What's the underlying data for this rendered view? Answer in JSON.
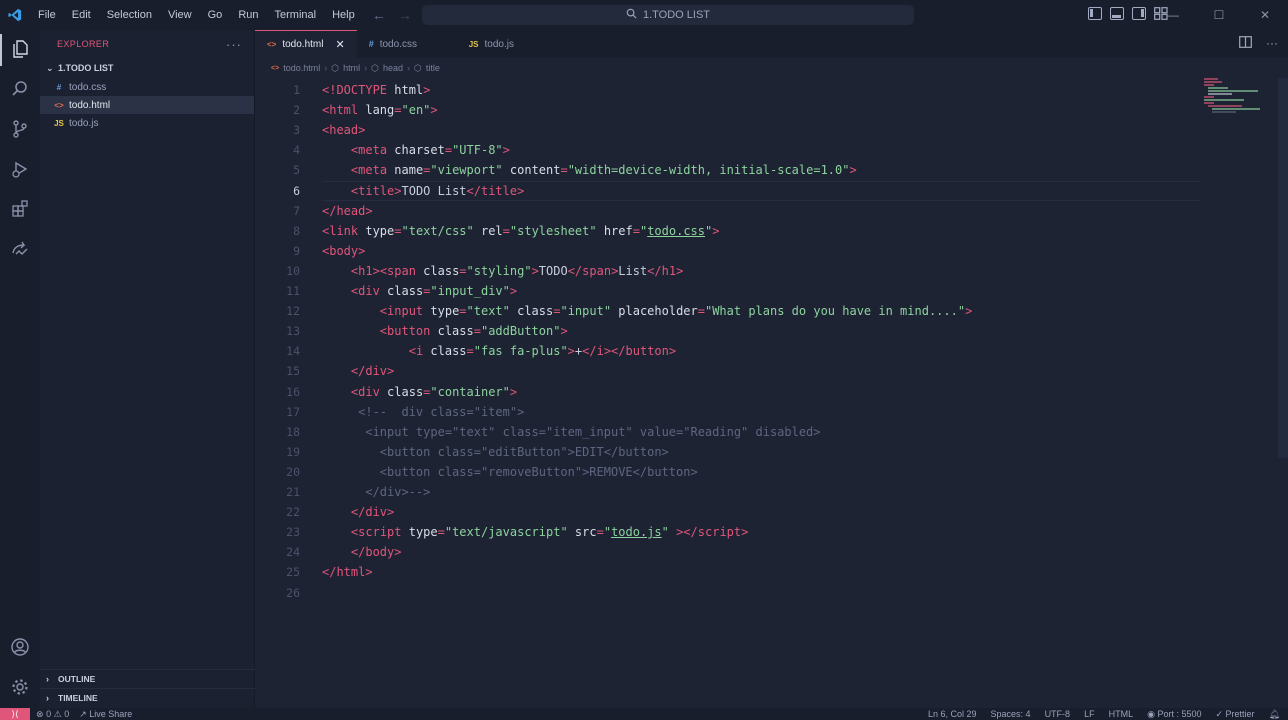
{
  "titlebar": {
    "menu": [
      "File",
      "Edit",
      "Selection",
      "View",
      "Go",
      "Run",
      "Terminal",
      "Help"
    ],
    "search_text": "1.TODO LIST"
  },
  "sidebar": {
    "header": "EXPLORER",
    "more": "···",
    "folder": "1.TODO LIST",
    "files": [
      {
        "icon": "#",
        "name": "todo.css",
        "color": "#6a9fdc"
      },
      {
        "icon": "<>",
        "name": "todo.html",
        "color": "#e06c4a"
      },
      {
        "icon": "JS",
        "name": "todo.js",
        "color": "#e3c449"
      }
    ],
    "outline": "OUTLINE",
    "timeline": "TIMELINE"
  },
  "tabs": [
    {
      "icon": "<>",
      "label": "todo.html",
      "color": "#e06c4a",
      "close": "✕"
    },
    {
      "icon": "#",
      "label": "todo.css",
      "color": "#6a9fdc"
    },
    {
      "icon": "JS",
      "label": "todo.js",
      "color": "#e3c449"
    }
  ],
  "breadcrumb": [
    "todo.html",
    "html",
    "head",
    "title"
  ],
  "code_lines": [
    {
      "n": "1",
      "html": "<span class='t-punc'>&lt;!DOCTYPE </span><span class='t-attr'>html</span><span class='t-punc'>&gt;</span>"
    },
    {
      "n": "2",
      "html": "<span class='t-punc'>&lt;</span><span class='t-tag'>html </span><span class='t-attr'>lang</span><span class='t-punc'>=</span><span class='t-str'>\"en\"</span><span class='t-punc'>&gt;</span>"
    },
    {
      "n": "3",
      "html": "<span class='t-punc'>&lt;</span><span class='t-tag'>head</span><span class='t-punc'>&gt;</span>"
    },
    {
      "n": "4",
      "html": "    <span class='t-punc'>&lt;</span><span class='t-tag'>meta </span><span class='t-attr'>charset</span><span class='t-punc'>=</span><span class='t-str'>\"UTF-8\"</span><span class='t-punc'>&gt;</span>"
    },
    {
      "n": "5",
      "html": "    <span class='t-punc'>&lt;</span><span class='t-tag'>meta </span><span class='t-attr'>name</span><span class='t-punc'>=</span><span class='t-str'>\"viewport\" </span><span class='t-attr'>content</span><span class='t-punc'>=</span><span class='t-str'>\"width=device-width, initial-scale=1.0\"</span><span class='t-punc'>&gt;</span>"
    },
    {
      "n": "6",
      "html": "    <span class='t-punc'>&lt;</span><span class='t-tag'>title</span><span class='t-punc'>&gt;</span><span class='t-text'>TODO List</span><span class='t-punc'>&lt;/</span><span class='t-tag'>title</span><span class='t-punc'>&gt;</span>",
      "current": true
    },
    {
      "n": "7",
      "html": "<span class='t-punc'>&lt;/</span><span class='t-tag'>head</span><span class='t-punc'>&gt;</span>"
    },
    {
      "n": "8",
      "html": "<span class='t-punc'>&lt;</span><span class='t-tag'>link </span><span class='t-attr'>type</span><span class='t-punc'>=</span><span class='t-str'>\"text/css\" </span><span class='t-attr'>rel</span><span class='t-punc'>=</span><span class='t-str'>\"stylesheet\" </span><span class='t-attr'>href</span><span class='t-punc'>=</span><span class='t-str'>\"</span><span class='t-link'>todo.css</span><span class='t-str'>\"</span><span class='t-punc'>&gt;</span>"
    },
    {
      "n": "9",
      "html": "<span class='t-punc'>&lt;</span><span class='t-tag'>body</span><span class='t-punc'>&gt;</span>"
    },
    {
      "n": "10",
      "html": "    <span class='t-punc'>&lt;</span><span class='t-tag'>h1</span><span class='t-punc'>&gt;&lt;</span><span class='t-tag'>span </span><span class='t-attr'>class</span><span class='t-punc'>=</span><span class='t-str'>\"styling\"</span><span class='t-punc'>&gt;</span><span class='t-text'>TODO</span><span class='t-punc'>&lt;/</span><span class='t-tag'>span</span><span class='t-punc'>&gt;</span><span class='t-text'>List</span><span class='t-punc'>&lt;/</span><span class='t-tag'>h1</span><span class='t-punc'>&gt;</span>"
    },
    {
      "n": "11",
      "html": "    <span class='t-punc'>&lt;</span><span class='t-tag'>div </span><span class='t-attr'>class</span><span class='t-punc'>=</span><span class='t-str'>\"input_div\"</span><span class='t-punc'>&gt;</span>"
    },
    {
      "n": "12",
      "html": "        <span class='t-punc'>&lt;</span><span class='t-tag'>input </span><span class='t-attr'>type</span><span class='t-punc'>=</span><span class='t-str'>\"text\" </span><span class='t-attr'>class</span><span class='t-punc'>=</span><span class='t-str'>\"input\" </span><span class='t-attr'>placeholder</span><span class='t-punc'>=</span><span class='t-str'>\"What plans do you have in mind....\"</span><span class='t-punc'>&gt;</span>"
    },
    {
      "n": "13",
      "html": "        <span class='t-punc'>&lt;</span><span class='t-tag'>button </span><span class='t-attr'>class</span><span class='t-punc'>=</span><span class='t-str'>\"addButton\"</span><span class='t-punc'>&gt;</span>"
    },
    {
      "n": "14",
      "html": "            <span class='t-punc'>&lt;</span><span class='t-tag'>i </span><span class='t-attr'>class</span><span class='t-punc'>=</span><span class='t-str'>\"fas fa-plus\"</span><span class='t-punc'>&gt;</span><span class='t-text'>+</span><span class='t-punc'>&lt;/</span><span class='t-tag'>i</span><span class='t-punc'>&gt;&lt;/</span><span class='t-tag'>button</span><span class='t-punc'>&gt;</span>"
    },
    {
      "n": "15",
      "html": "    <span class='t-punc'>&lt;/</span><span class='t-tag'>div</span><span class='t-punc'>&gt;</span>"
    },
    {
      "n": "16",
      "html": "    <span class='t-punc'>&lt;</span><span class='t-tag'>div </span><span class='t-attr'>class</span><span class='t-punc'>=</span><span class='t-str'>\"container\"</span><span class='t-punc'>&gt;</span>"
    },
    {
      "n": "17",
      "html": "     <span class='t-cmt'>&lt;!--  div class=\"item\"&gt;</span>"
    },
    {
      "n": "18",
      "html": "      <span class='t-cmt'>&lt;input type=\"text\" class=\"item_input\" value=\"Reading\" disabled&gt;</span>"
    },
    {
      "n": "19",
      "html": "        <span class='t-cmt'>&lt;button class=\"editButton\"&gt;EDIT&lt;/button&gt;</span>"
    },
    {
      "n": "20",
      "html": "        <span class='t-cmt'>&lt;button class=\"removeButton\"&gt;REMOVE&lt;/button&gt;</span>"
    },
    {
      "n": "21",
      "html": "      <span class='t-cmt'>&lt;/div&gt;--&gt;</span>"
    },
    {
      "n": "22",
      "html": "    <span class='t-punc'>&lt;/</span><span class='t-tag'>div</span><span class='t-punc'>&gt;</span>"
    },
    {
      "n": "23",
      "html": "    <span class='t-punc'>&lt;</span><span class='t-tag'>script </span><span class='t-attr'>type</span><span class='t-punc'>=</span><span class='t-str'>\"text/javascript\" </span><span class='t-attr'>src</span><span class='t-punc'>=</span><span class='t-str'>\"</span><span class='t-link'>todo.js</span><span class='t-str'>\" </span><span class='t-punc'>&gt;&lt;/</span><span class='t-tag'>script</span><span class='t-punc'>&gt;</span>"
    },
    {
      "n": "24",
      "html": "    <span class='t-punc'>&lt;/</span><span class='t-tag'>body</span><span class='t-punc'>&gt;</span>"
    },
    {
      "n": "25",
      "html": "<span class='t-punc'>&lt;/</span><span class='t-tag'>html</span><span class='t-punc'>&gt;</span>"
    },
    {
      "n": "26",
      "html": ""
    }
  ],
  "statusbar": {
    "errors": "0",
    "warnings": "0",
    "live_share": "Live Share",
    "position": "Ln 6, Col 29",
    "spaces": "Spaces: 4",
    "encoding": "UTF-8",
    "eol": "LF",
    "language": "HTML",
    "port": "Port : 5500",
    "prettier": "Prettier"
  },
  "colors": {
    "accent": "#e0567a",
    "background": "#1d2333"
  }
}
